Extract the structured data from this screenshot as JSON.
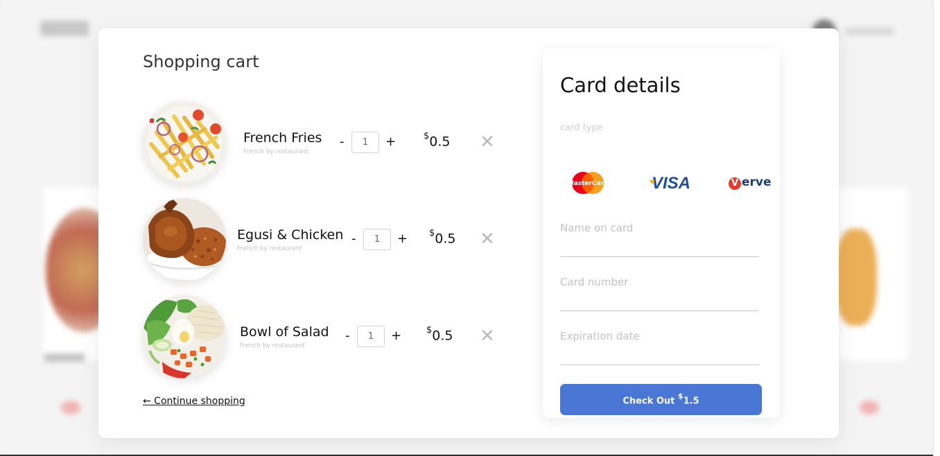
{
  "cart": {
    "title": "Shopping cart",
    "continue_label": "← Continue shopping",
    "items": [
      {
        "name": "French Fries",
        "subtitle": "French by restaurant",
        "quantity": "1",
        "minus": "-",
        "plus": "+",
        "currency": "$",
        "price": "0.5",
        "remove": "X"
      },
      {
        "name": "Egusi & Chicken",
        "subtitle": "French by restaurant",
        "quantity": "1",
        "minus": "-",
        "plus": "+",
        "currency": "$",
        "price": "0.5",
        "remove": "X"
      },
      {
        "name": "Bowl of Salad",
        "subtitle": "French by restaurant",
        "quantity": "1",
        "minus": "-",
        "plus": "+",
        "currency": "$",
        "price": "0.5",
        "remove": "X"
      }
    ]
  },
  "card": {
    "title": "Card details",
    "card_type_label": "card type",
    "card_logos": [
      "MasterCard",
      "VISA",
      "erve"
    ],
    "verve_initial": "V",
    "name_label": "Name on card",
    "number_label": "Card number",
    "expiry_label": "Expiration date",
    "checkout_label": "Check Out",
    "checkout_currency": "$",
    "checkout_total": "1.5"
  },
  "colors": {
    "accent": "#4a76d6",
    "mastercard_red": "#eb001b",
    "mastercard_orange": "#f79e1b",
    "visa_blue": "#1a4fa0",
    "verve_red": "#e63a2c"
  }
}
